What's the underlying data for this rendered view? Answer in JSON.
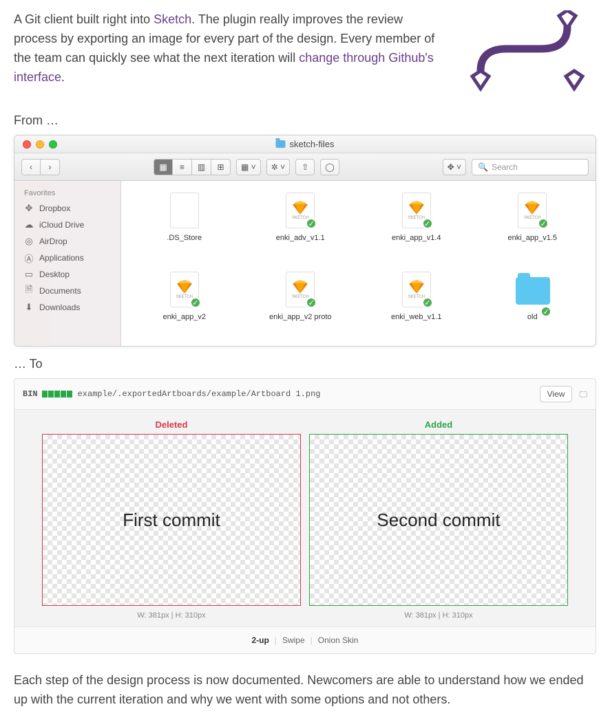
{
  "intro": {
    "p1a": "A Git client built right into ",
    "link1": "Sketch",
    "p1b": ". The plugin really improves the review process by exporting an image for every part of the design. Every member of the team can quickly see what the next iteration will ",
    "link2": "change through Github's interface",
    "p1c": "."
  },
  "labels": {
    "from": "From …",
    "to": "… To"
  },
  "finder": {
    "title": "sketch-files",
    "search_placeholder": "Search",
    "sidebar_header": "Favorites",
    "sidebar": [
      {
        "icon": "dropbox",
        "label": "Dropbox"
      },
      {
        "icon": "cloud",
        "label": "iCloud Drive"
      },
      {
        "icon": "airdrop",
        "label": "AirDrop"
      },
      {
        "icon": "apps",
        "label": "Applications"
      },
      {
        "icon": "desktop",
        "label": "Desktop"
      },
      {
        "icon": "docs",
        "label": "Documents"
      },
      {
        "icon": "downloads",
        "label": "Downloads"
      }
    ],
    "files": [
      {
        "type": "blank",
        "name": ".DS_Store",
        "synced": false
      },
      {
        "type": "sketch",
        "name": "enki_adv_v1.1",
        "synced": true
      },
      {
        "type": "sketch",
        "name": "enki_app_v1.4",
        "synced": true
      },
      {
        "type": "sketch",
        "name": "enki_app_v1.5",
        "synced": true
      },
      {
        "type": "sketch",
        "name": "enki_app_v2",
        "synced": true
      },
      {
        "type": "sketch",
        "name": "enki_app_v2 proto",
        "synced": true
      },
      {
        "type": "sketch",
        "name": "enki_web_v1.1",
        "synced": true
      },
      {
        "type": "folder",
        "name": "old",
        "synced": true
      }
    ]
  },
  "diff": {
    "bin": "BIN",
    "path": "example/.exportedArtboards/example/Artboard 1.png",
    "view_btn": "View",
    "deleted_label": "Deleted",
    "added_label": "Added",
    "deleted_text": "First commit",
    "added_text": "Second commit",
    "dim_deleted": "W: 381px | H: 310px",
    "dim_added": "W: 381px | H: 310px",
    "tabs": [
      "2-up",
      "Swipe",
      "Onion Skin"
    ],
    "tab_active": 0
  },
  "outro": "Each step of the design process is now documented. Newcomers are able to understand how we ended up with the current iteration and why we went with some options and not others."
}
